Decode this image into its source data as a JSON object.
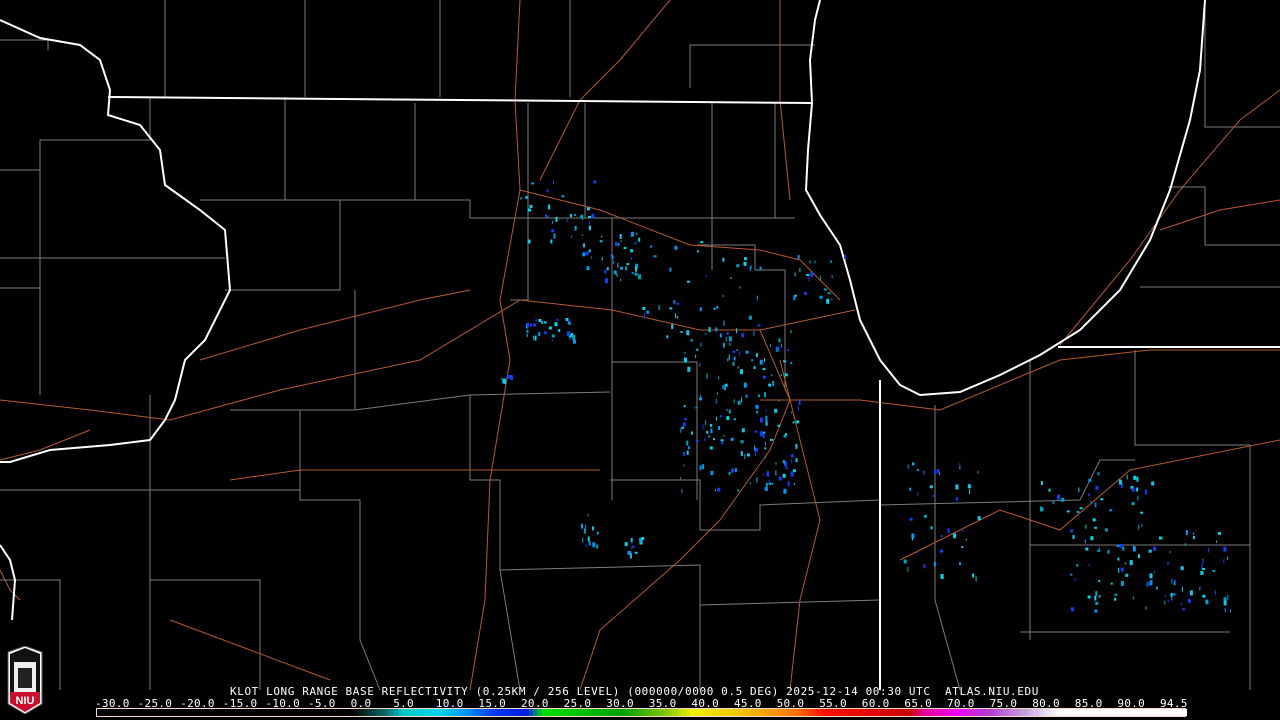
{
  "product": {
    "title": "KLOT LONG RANGE BASE REFLECTIVITY (0.25KM / 256 LEVEL) (000000/0000 0.5 DEG) 2025-12-14 00:30 UTC  ATLAS.NIU.EDU",
    "radar": "KLOT",
    "timestamp": "2025-12-14 00:30 UTC",
    "source": "ATLAS.NIU.EDU"
  },
  "logo": {
    "text": "NIU",
    "color": "#c8102e"
  },
  "colorbar": {
    "labels": [
      "-30.0",
      "-25.0",
      "-20.0",
      "-15.0",
      "-10.0",
      "-5.0",
      "0.0",
      "5.0",
      "10.0",
      "15.0",
      "20.0",
      "25.0",
      "30.0",
      "35.0",
      "40.0",
      "45.0",
      "50.0",
      "55.0",
      "60.0",
      "65.0",
      "70.0",
      "75.0",
      "80.0",
      "85.0",
      "90.0",
      "94.5"
    ],
    "range": [
      -30,
      94.5
    ],
    "stops": [
      {
        "v": -30,
        "c": "#000000"
      },
      {
        "v": -1,
        "c": "#000000"
      },
      {
        "v": 0,
        "c": "#0a1818"
      },
      {
        "v": 3,
        "c": "#0a6a6a"
      },
      {
        "v": 5,
        "c": "#00c8c8"
      },
      {
        "v": 9,
        "c": "#00d8ea"
      },
      {
        "v": 12,
        "c": "#0098f0"
      },
      {
        "v": 15,
        "c": "#0040f0"
      },
      {
        "v": 19,
        "c": "#0018e0"
      },
      {
        "v": 20,
        "c": "#007a8a"
      },
      {
        "v": 21,
        "c": "#00e000"
      },
      {
        "v": 30,
        "c": "#00a000"
      },
      {
        "v": 35,
        "c": "#80c800"
      },
      {
        "v": 38,
        "c": "#f0f000"
      },
      {
        "v": 44,
        "c": "#f0c000"
      },
      {
        "v": 50,
        "c": "#ff7000"
      },
      {
        "v": 53,
        "c": "#ff1000"
      },
      {
        "v": 63,
        "c": "#c80000"
      },
      {
        "v": 64,
        "c": "#e00080"
      },
      {
        "v": 68,
        "c": "#f000f0"
      },
      {
        "v": 72,
        "c": "#b040d0"
      },
      {
        "v": 76,
        "c": "#c8a0e0"
      },
      {
        "v": 79,
        "c": "#f0e8f8"
      },
      {
        "v": 80,
        "c": "#ffffff"
      },
      {
        "v": 94.5,
        "c": "#ffffff"
      }
    ]
  },
  "map_colors": {
    "state": "#ffffff",
    "county": "#8a8a8a",
    "road": "#b05a30",
    "echo": "#19c8e8"
  }
}
